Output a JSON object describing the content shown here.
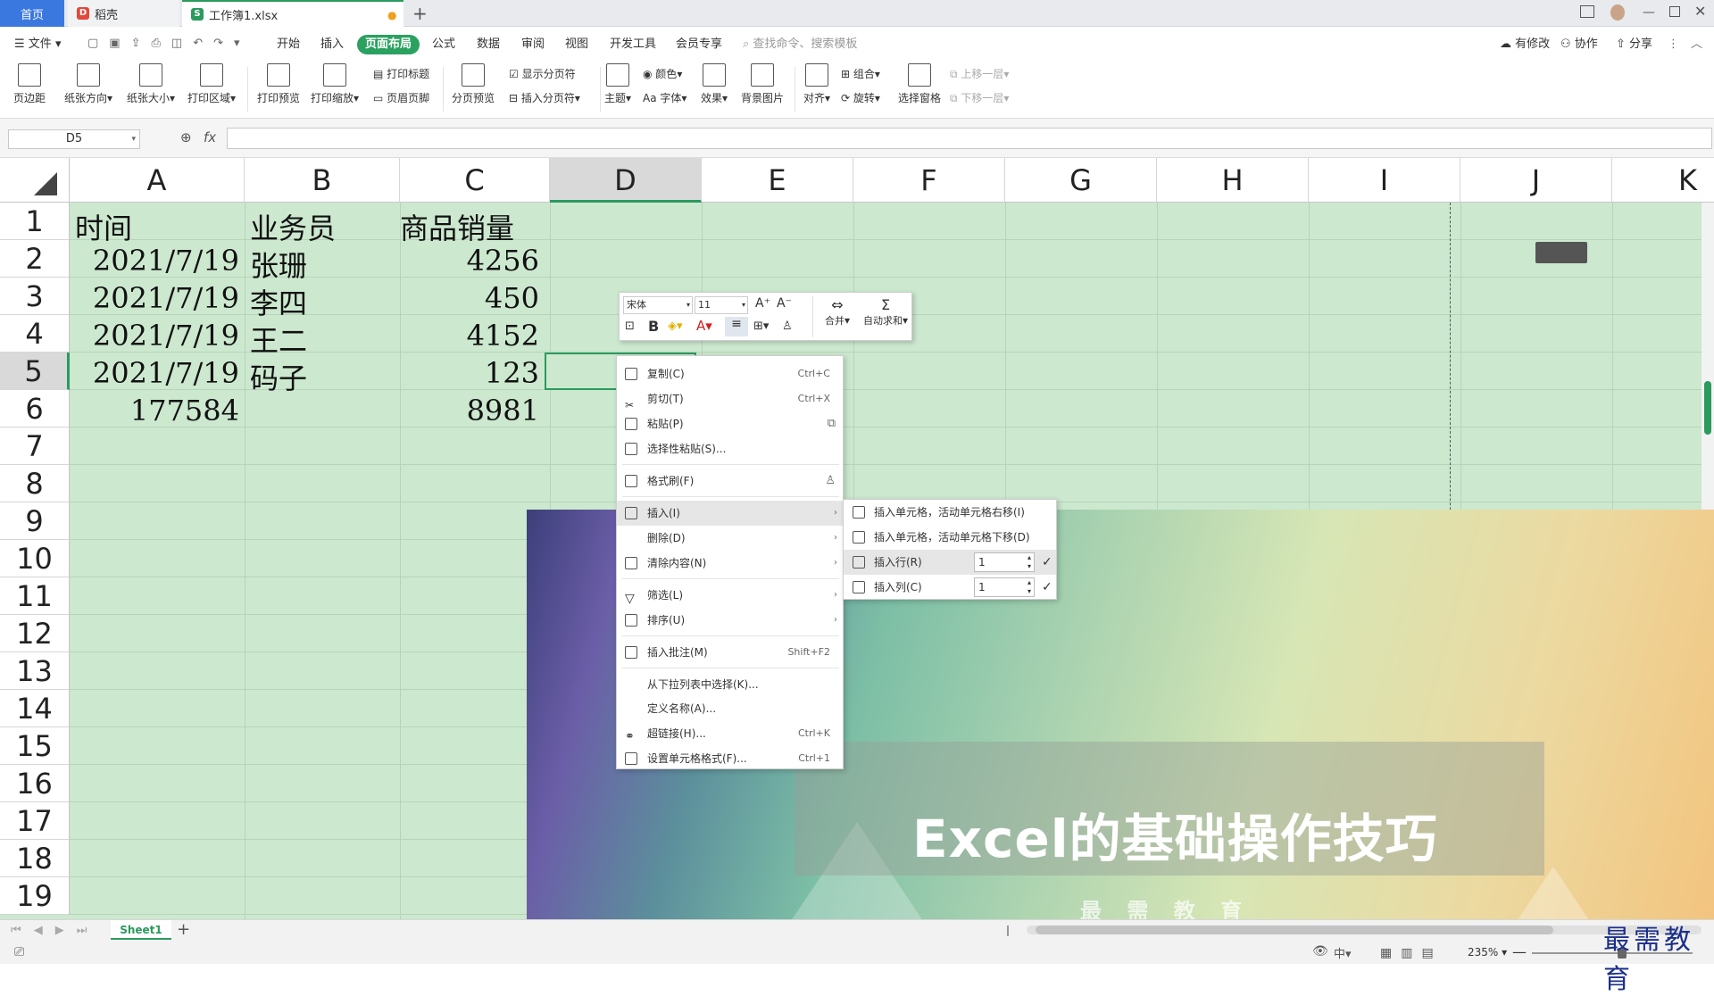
{
  "tabs": {
    "home": "首页",
    "daoke": "稻壳",
    "workbook": "工作簿1.xlsx",
    "add": "+"
  },
  "menu": {
    "file": "文件",
    "items": [
      "开始",
      "插入",
      "页面布局",
      "公式",
      "数据",
      "审阅",
      "视图",
      "开发工具",
      "会员专享"
    ],
    "active": "页面布局",
    "search": "查找命令、搜索模板",
    "right": [
      "有修改",
      "协作",
      "分享"
    ]
  },
  "ribbon": {
    "margins": "页边距",
    "orientation": "纸张方向",
    "size": "纸张大小",
    "print_area": "打印区域",
    "print_preview": "打印预览",
    "print_scale": "打印缩放",
    "print_titles": "打印标题",
    "header_footer": "页眉页脚",
    "page_break_preview": "分页预览",
    "show_breaks": "显示分页符",
    "insert_break": "插入分页符",
    "theme": "主题",
    "colors": "颜色",
    "fonts": "字体",
    "effects": "效果",
    "background": "背景图片",
    "align": "对齐",
    "group": "组合",
    "rotate": "旋转",
    "selection_pane": "选择窗格",
    "bring_forward": "上移一层",
    "send_backward": "下移一层"
  },
  "formula_bar": {
    "name_box": "D5",
    "fx": "fx",
    "value": ""
  },
  "columns": [
    "A",
    "B",
    "C",
    "D",
    "E",
    "F",
    "G",
    "H",
    "I",
    "J",
    "K"
  ],
  "rows": [
    "1",
    "2",
    "3",
    "4",
    "5",
    "6",
    "7",
    "8",
    "9",
    "10",
    "11",
    "12",
    "13",
    "14",
    "15",
    "16",
    "17",
    "18",
    "19"
  ],
  "cells": {
    "a1": "时间",
    "b1": "业务员",
    "c1": "商品销量",
    "a2": "2021/7/19",
    "b2": "张珊",
    "c2": "4256",
    "a3": "2021/7/19",
    "b3": "李四",
    "c3": "450",
    "a4": "2021/7/19",
    "b4": "王二",
    "c4": "4152",
    "a5": "2021/7/19",
    "b5": "码子",
    "c5": "123",
    "a6": "177584",
    "c6": "8981"
  },
  "mini_toolbar": {
    "font": "宋体",
    "size": "11",
    "merge": "合并",
    "autosum": "自动求和"
  },
  "context_menu": {
    "copy": "复制(C)",
    "copy_sc": "Ctrl+C",
    "cut": "剪切(T)",
    "cut_sc": "Ctrl+X",
    "paste": "粘贴(P)",
    "paste_special": "选择性粘贴(S)...",
    "format_painter": "格式刷(F)",
    "insert": "插入(I)",
    "delete": "删除(D)",
    "clear": "清除内容(N)",
    "filter": "筛选(L)",
    "sort": "排序(U)",
    "comment": "插入批注(M)",
    "comment_sc": "Shift+F2",
    "pick_list": "从下拉列表中选择(K)...",
    "define_name": "定义名称(A)...",
    "hyperlink": "超链接(H)...",
    "hyperlink_sc": "Ctrl+K",
    "format_cells": "设置单元格格式(F)...",
    "format_cells_sc": "Ctrl+1"
  },
  "insert_submenu": {
    "shift_right": "插入单元格，活动单元格右移(I)",
    "shift_down": "插入单元格，活动单元格下移(D)",
    "row": "插入行(R)",
    "row_count": "1",
    "col": "插入列(C)",
    "col_count": "1"
  },
  "video_title": "Excel的基础操作技巧",
  "video_sub": "最 需 教 育",
  "sheet_tab": "Sheet1",
  "zoom": "235%",
  "watermark": "最需教育"
}
